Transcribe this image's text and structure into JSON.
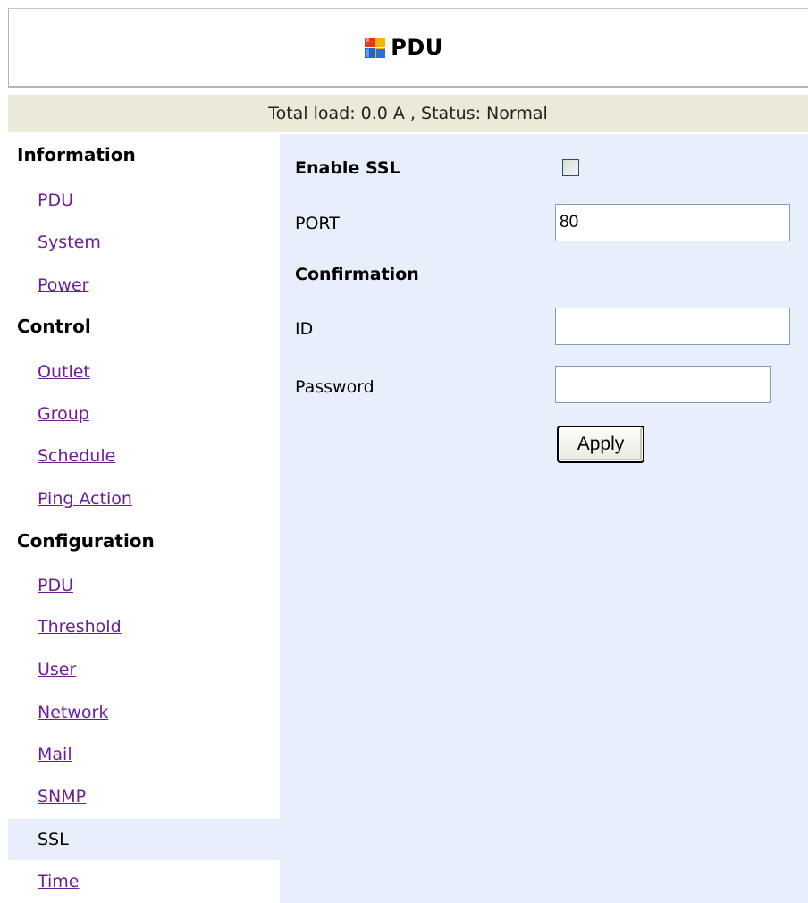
{
  "header": {
    "title": "PDU",
    "logo_icon": "windows-logo-icon"
  },
  "status_bar": {
    "text": "Total load: 0.0 A , Status: Normal"
  },
  "sidebar": {
    "information": {
      "heading": "Information",
      "items": [
        "PDU",
        "System",
        "Power"
      ]
    },
    "control": {
      "heading": "Control",
      "items": [
        "Outlet",
        "Group",
        "Schedule",
        "Ping Action"
      ]
    },
    "configuration": {
      "heading": "Configuration",
      "items": [
        "PDU",
        "Threshold",
        "User",
        "Network",
        "Mail",
        "SNMP",
        "SSL",
        "Time"
      ],
      "active_item": "SSL"
    }
  },
  "form": {
    "enable_ssl_label": "Enable SSL",
    "enable_ssl_checked": false,
    "port_label": "PORT",
    "port_value": "80",
    "confirmation_heading": "Confirmation",
    "id_label": "ID",
    "id_value": "",
    "password_label": "Password",
    "password_value": "",
    "apply_label": "Apply"
  },
  "colors": {
    "link": "#6b1e96",
    "status_bar_bg": "#ece9d8",
    "content_bg": "#e8effa"
  }
}
